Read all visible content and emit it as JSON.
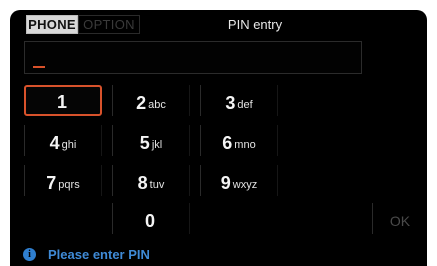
{
  "tabs": [
    {
      "label": "PHONE",
      "active": true
    },
    {
      "label": "OPTION",
      "active": false
    }
  ],
  "title": "PIN entry",
  "pin_entry": {
    "value": ""
  },
  "keypad": [
    {
      "digit": "1",
      "letters": ""
    },
    {
      "digit": "2",
      "letters": "abc"
    },
    {
      "digit": "3",
      "letters": "def"
    },
    {
      "digit": "4",
      "letters": "ghi"
    },
    {
      "digit": "5",
      "letters": "jkl"
    },
    {
      "digit": "6",
      "letters": "mno"
    },
    {
      "digit": "7",
      "letters": "pqrs"
    },
    {
      "digit": "8",
      "letters": "tuv"
    },
    {
      "digit": "9",
      "letters": "wxyz"
    },
    {
      "digit": "0",
      "letters": ""
    }
  ],
  "ok_label": "OK",
  "status": {
    "icon": "info-icon",
    "text": "Please enter PIN"
  },
  "colors": {
    "selection": "#d8522b",
    "status": "#3f8ad6",
    "background": "#000000"
  }
}
